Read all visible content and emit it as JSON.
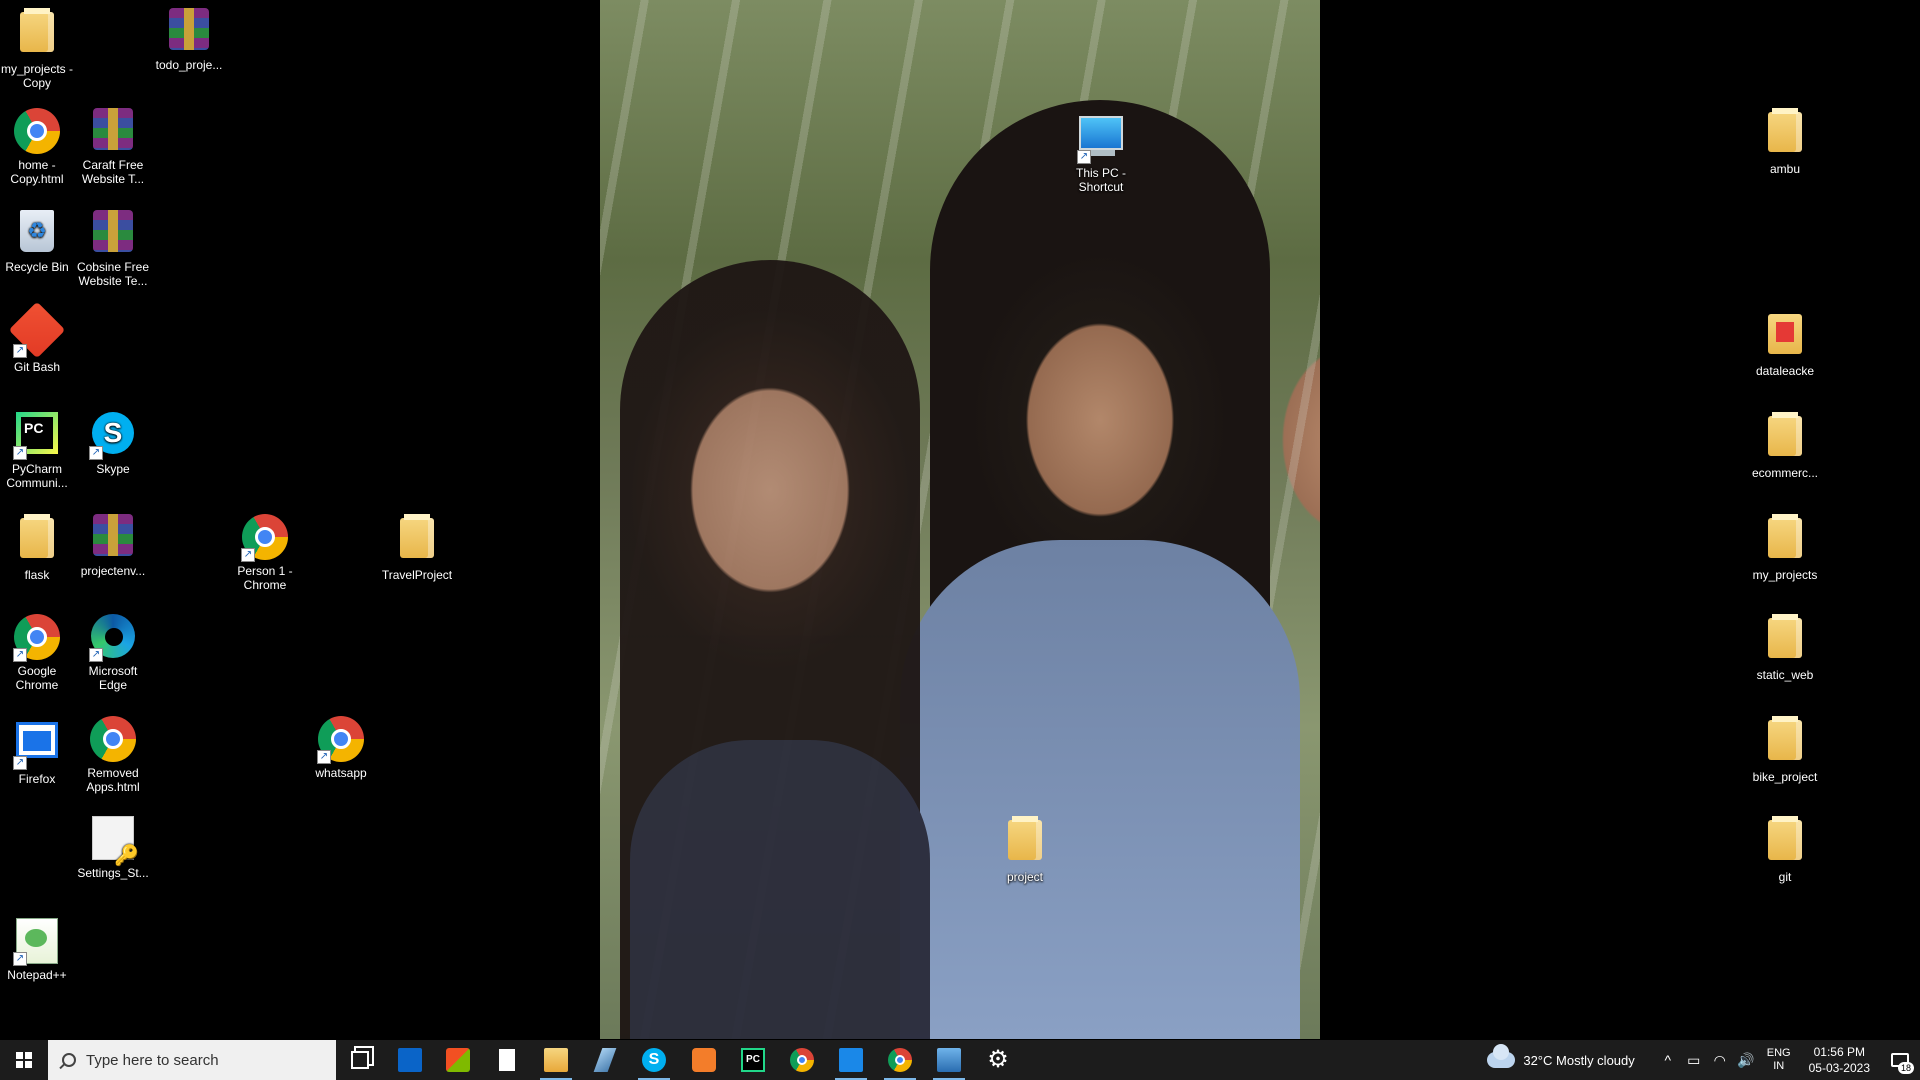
{
  "desktop": {
    "icons": [
      {
        "label": "my_projects - Copy"
      },
      {
        "label": "todo_proje..."
      },
      {
        "label": "home - Copy.html"
      },
      {
        "label": "Caraft Free Website T..."
      },
      {
        "label": "Recycle Bin"
      },
      {
        "label": "Cobsine Free Website Te..."
      },
      {
        "label": "Git Bash"
      },
      {
        "label": "PyCharm Communi..."
      },
      {
        "label": "Skype"
      },
      {
        "label": "flask"
      },
      {
        "label": "projectenv..."
      },
      {
        "label": "Person 1 - Chrome"
      },
      {
        "label": "TravelProject"
      },
      {
        "label": "Google Chrome"
      },
      {
        "label": "Microsoft Edge"
      },
      {
        "label": "Firefox"
      },
      {
        "label": "Removed Apps.html"
      },
      {
        "label": "whatsapp"
      },
      {
        "label": "Settings_St..."
      },
      {
        "label": "Notepad++"
      },
      {
        "label": "This PC - Shortcut"
      },
      {
        "label": "project"
      },
      {
        "label": "ambu"
      },
      {
        "label": "dataleacke"
      },
      {
        "label": "ecommerc..."
      },
      {
        "label": "my_projects"
      },
      {
        "label": "static_web"
      },
      {
        "label": "bike_project"
      },
      {
        "label": "git"
      }
    ]
  },
  "taskbar": {
    "search_placeholder": "Type here to search",
    "apps": [
      {
        "icon": "task-view-icon"
      },
      {
        "icon": "mail-icon"
      },
      {
        "icon": "store-icon"
      },
      {
        "icon": "notepad-icon"
      },
      {
        "icon": "file-explorer-icon"
      },
      {
        "icon": "snipping-tool-icon"
      },
      {
        "icon": "skype-icon"
      },
      {
        "icon": "sublime-text-icon"
      },
      {
        "icon": "pycharm-icon"
      },
      {
        "icon": "chrome-icon"
      },
      {
        "icon": "screen-app-icon"
      },
      {
        "icon": "chrome-profile-icon"
      },
      {
        "icon": "photos-icon"
      },
      {
        "icon": "settings-icon"
      }
    ],
    "weather": {
      "temp": "32°C",
      "condition": "Mostly cloudy"
    },
    "language": {
      "line1": "ENG",
      "line2": "IN"
    },
    "clock": {
      "time": "01:56 PM",
      "date": "05-03-2023"
    },
    "notification_count": "18"
  }
}
